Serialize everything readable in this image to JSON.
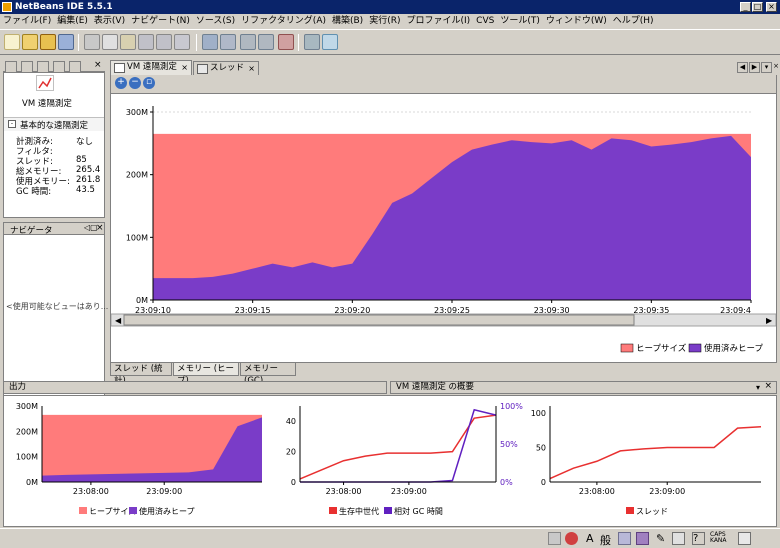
{
  "window": {
    "title": "NetBeans IDE 5.5.1"
  },
  "menu": [
    "ファイル(F)",
    "編集(E)",
    "表示(V)",
    "ナビゲート(N)",
    "ソース(S)",
    "リファクタリング(A)",
    "構築(B)",
    "実行(R)",
    "プロファイル(I)",
    "CVS",
    "ツール(T)",
    "ウィンドウ(W)",
    "ヘルプ(H)"
  ],
  "left_panel": {
    "title": "VM 遠隔測定",
    "section": "基本的な遠隔測定",
    "rows": [
      {
        "label": "計測済み:",
        "value": "なし"
      },
      {
        "label": "フィルタ:",
        "value": ""
      },
      {
        "label": "スレッド:",
        "value": "85"
      },
      {
        "label": "総メモリー:",
        "value": "265.4"
      },
      {
        "label": "使用メモリー:",
        "value": "261.8"
      },
      {
        "label": "GC 時間:",
        "value": "43.5"
      }
    ]
  },
  "navigator": {
    "title": "ナビゲータ",
    "empty": "<使用可能なビューはあり..."
  },
  "editor_tabs": [
    {
      "label": "VM 遠隔測定",
      "active": true
    },
    {
      "label": "スレッド",
      "active": false
    }
  ],
  "bottom_tabs": [
    "スレッド (統計)",
    "メモリー (ヒープ)",
    "メモリー (GC)"
  ],
  "main_chart": {
    "chart_data": {
      "type": "area",
      "x": [
        "23:09:10",
        "23:09:11",
        "23:09:12",
        "23:09:13",
        "23:09:14",
        "23:09:15",
        "23:09:16",
        "23:09:17",
        "23:09:18",
        "23:09:19",
        "23:09:20",
        "23:09:21",
        "23:09:22",
        "23:09:23",
        "23:09:24",
        "23:09:25",
        "23:09:26",
        "23:09:27",
        "23:09:28",
        "23:09:29",
        "23:09:30",
        "23:09:31",
        "23:09:32",
        "23:09:33",
        "23:09:34",
        "23:09:35",
        "23:09:36",
        "23:09:37",
        "23:09:38",
        "23:09:39",
        "23:09:40"
      ],
      "series": [
        {
          "name": "ヒープサイズ",
          "color": "#ff7b7b",
          "values": [
            265,
            265,
            265,
            265,
            265,
            265,
            265,
            265,
            265,
            265,
            265,
            265,
            265,
            265,
            265,
            265,
            265,
            265,
            265,
            265,
            265,
            265,
            265,
            265,
            265,
            265,
            265,
            265,
            265,
            265,
            265
          ]
        },
        {
          "name": "使用済みヒープ",
          "color": "#7a3cc8",
          "values": [
            35,
            35,
            35,
            37,
            42,
            50,
            58,
            52,
            60,
            52,
            58,
            105,
            155,
            170,
            195,
            220,
            240,
            248,
            255,
            252,
            250,
            255,
            240,
            258,
            255,
            245,
            248,
            252,
            258,
            262,
            228
          ]
        }
      ],
      "yticks": [
        "0M",
        "100M",
        "200M",
        "300M"
      ],
      "xticks": [
        "23:09:10",
        "23:09:15",
        "23:09:20",
        "23:09:25",
        "23:09:30",
        "23:09:35",
        "23:09:4"
      ],
      "ylim": [
        0,
        300
      ],
      "legend": [
        "ヒープサイズ",
        "使用済みヒープ"
      ]
    }
  },
  "output": {
    "title": "出力"
  },
  "summary": {
    "title": "VM 遠隔測定 の概要",
    "charts": [
      {
        "type": "area",
        "yticks": [
          "0M",
          "100M",
          "200M",
          "300M"
        ],
        "xticks": [
          "23:08:00",
          "23:09:00"
        ],
        "legend": [
          "ヒープサイズ",
          "使用済みヒープ"
        ],
        "x": [
          "23:07:20",
          "23:07:40",
          "23:08:00",
          "23:08:20",
          "23:08:40",
          "23:09:00",
          "23:09:10",
          "23:09:20",
          "23:09:30",
          "23:09:40"
        ],
        "series": [
          {
            "name": "ヒープサイズ",
            "values": [
              265,
              265,
              265,
              265,
              265,
              265,
              265,
              265,
              265,
              265
            ]
          },
          {
            "name": "使用済みヒープ",
            "values": [
              25,
              28,
              30,
              32,
              34,
              36,
              38,
              50,
              220,
              255
            ]
          }
        ],
        "ylim": [
          0,
          300
        ]
      },
      {
        "type": "line",
        "yticks": [
          "0",
          "20",
          "40"
        ],
        "y2ticks": [
          "0%",
          "50%",
          "100%"
        ],
        "xticks": [
          "23:08:00",
          "23:09:00"
        ],
        "legend": [
          "生存中世代",
          "相対 GC 時間"
        ],
        "x": [
          "23:07:20",
          "23:07:40",
          "23:08:00",
          "23:08:20",
          "23:08:40",
          "23:09:00",
          "23:09:10",
          "23:09:20",
          "23:09:30",
          "23:09:40"
        ],
        "series": [
          {
            "name": "生存中世代",
            "values": [
              2,
              8,
              14,
              17,
              19,
              19,
              19,
              20,
              42,
              44
            ]
          },
          {
            "name": "相対 GC 時間",
            "values": [
              0,
              0,
              0,
              0,
              0,
              0,
              0,
              2,
              95,
              88
            ]
          }
        ]
      },
      {
        "type": "line",
        "yticks": [
          "0",
          "50",
          "100"
        ],
        "xticks": [
          "23:08:00",
          "23:09:00"
        ],
        "legend": [
          "スレッド"
        ],
        "x": [
          "23:07:20",
          "23:07:40",
          "23:08:00",
          "23:08:20",
          "23:08:40",
          "23:09:00",
          "23:09:10",
          "23:09:20",
          "23:09:30",
          "23:09:40"
        ],
        "series": [
          {
            "name": "スレッド",
            "values": [
              5,
              20,
              30,
              45,
              48,
              50,
              50,
              50,
              78,
              80
            ]
          }
        ]
      }
    ]
  },
  "colors": {
    "heap": "#ff7b7b",
    "used": "#7a3cc8",
    "red_line": "#e83030",
    "purple_line": "#6020c0"
  }
}
